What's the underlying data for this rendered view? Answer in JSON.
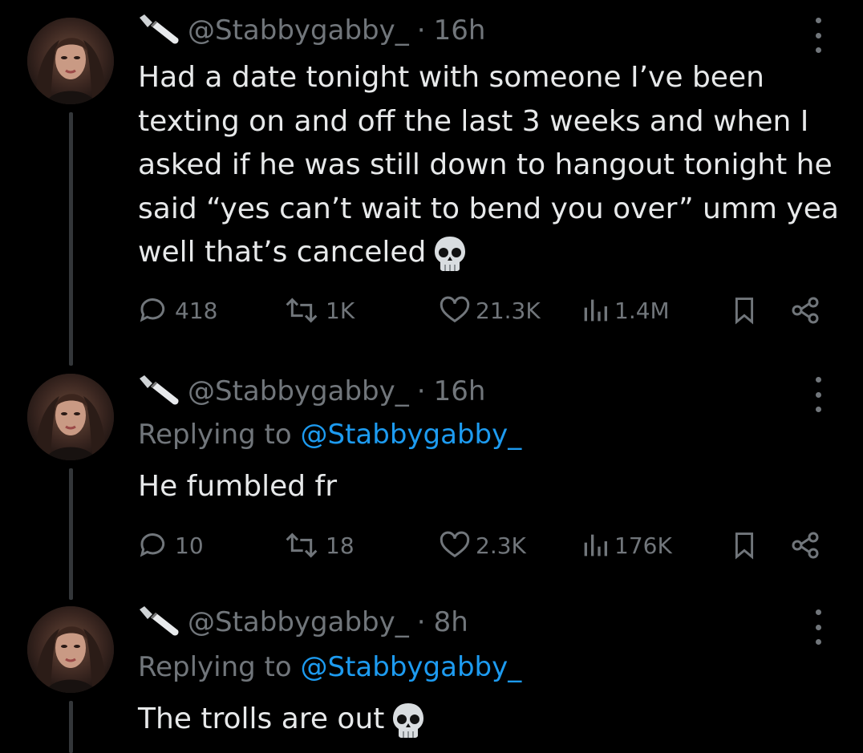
{
  "tweets": [
    {
      "handle": "@Stabbygabby_",
      "separator": "·",
      "time": "16h",
      "text": "Had a date tonight with someone I’ve been texting on and off the last 3 weeks and when I asked if he was still down to hangout tonight he said “yes can’t wait to bend you over” umm yea well that’s canceled",
      "emoji_icon": "skull-emoji",
      "replies": "418",
      "reposts": "1K",
      "likes": "21.3K",
      "views": "1.4M"
    },
    {
      "handle": "@Stabbygabby_",
      "separator": "·",
      "time": "16h",
      "replying_prefix": "Replying to",
      "replying_to": "@Stabbygabby_",
      "text": "He fumbled fr",
      "replies": "10",
      "reposts": "18",
      "likes": "2.3K",
      "views": "176K"
    },
    {
      "handle": "@Stabbygabby_",
      "separator": "·",
      "time": "8h",
      "replying_prefix": "Replying to",
      "replying_to": "@Stabbygabby_",
      "text": "The trolls are out",
      "emoji_icon": "skull-emoji"
    }
  ],
  "colors": {
    "background": "#000000",
    "text": "#e7e9ea",
    "secondary": "#71767b",
    "link": "#1d9bf0",
    "thread_line": "#333639"
  },
  "icons": [
    "knife-icon",
    "more-icon",
    "reply-icon",
    "repost-icon",
    "like-icon",
    "views-icon",
    "bookmark-icon",
    "share-icon",
    "skull-emoji"
  ]
}
